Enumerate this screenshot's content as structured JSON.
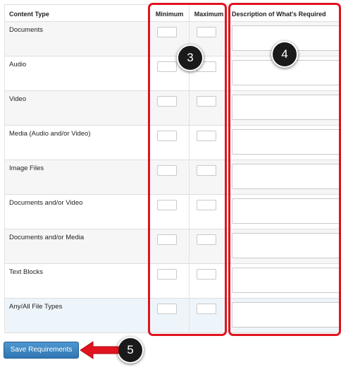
{
  "table": {
    "headers": {
      "content_type": "Content Type",
      "minimum": "Minimum",
      "maximum": "Maximum",
      "description": "Description of What's Required"
    },
    "rows": [
      {
        "content_type": "Documents"
      },
      {
        "content_type": "Audio"
      },
      {
        "content_type": "Video"
      },
      {
        "content_type": "Media (Audio and/or Video)"
      },
      {
        "content_type": "Image Files"
      },
      {
        "content_type": "Documents and/or Video"
      },
      {
        "content_type": "Documents and/or Media"
      },
      {
        "content_type": "Text Blocks"
      },
      {
        "content_type": "Any/All File Types"
      }
    ]
  },
  "callouts": {
    "step_3": "3",
    "step_4": "4",
    "step_5": "5"
  },
  "actions": {
    "save_label": "Save Requirements"
  },
  "colors": {
    "highlight": "#e0131f",
    "button": "#3a83c0",
    "badge": "#1a1a1a"
  }
}
